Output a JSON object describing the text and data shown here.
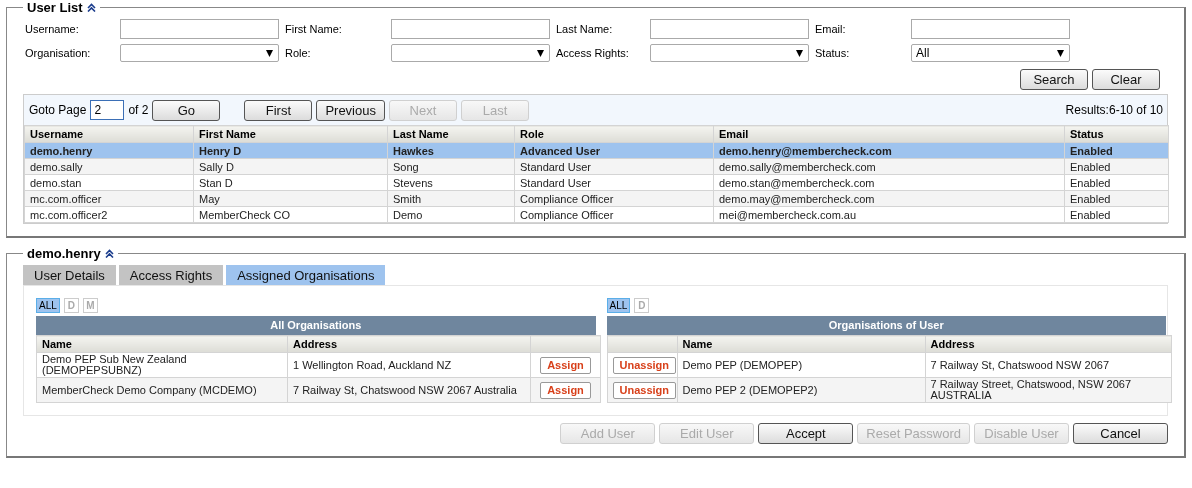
{
  "user_list": {
    "title": "User List",
    "filters": [
      {
        "kind": "text",
        "label": "Username:"
      },
      {
        "kind": "text",
        "label": "First Name:"
      },
      {
        "kind": "text",
        "label": "Last Name:"
      },
      {
        "kind": "text",
        "label": "Email:"
      },
      {
        "kind": "select",
        "label": "Organisation:"
      },
      {
        "kind": "select",
        "label": "Role:"
      },
      {
        "kind": "select",
        "label": "Access Rights:"
      },
      {
        "kind": "select",
        "label": "Status:",
        "value": "All"
      }
    ],
    "buttons": [
      {
        "label": "Search"
      },
      {
        "label": "Clear"
      }
    ],
    "pager": {
      "goto_label": "Goto Page",
      "page": "2",
      "of": "of 2",
      "go": "Go",
      "buttons": [
        {
          "label": "First",
          "disabled": false
        },
        {
          "label": "Previous",
          "disabled": false
        },
        {
          "label": "Next",
          "disabled": true
        },
        {
          "label": "Last",
          "disabled": true
        }
      ],
      "results": "Results:6-10 of 10"
    },
    "table": {
      "columns": [
        "Username",
        "First Name",
        "Last Name",
        "Role",
        "Email",
        "Status"
      ],
      "rows": [
        {
          "selected": true,
          "cells": [
            "demo.henry",
            "Henry D",
            "Hawkes",
            "Advanced User",
            "demo.henry@membercheck.com",
            "Enabled"
          ]
        },
        {
          "selected": false,
          "cells": [
            "demo.sally",
            "Sally D",
            "Song",
            "Standard User",
            "demo.sally@membercheck.com",
            "Enabled"
          ]
        },
        {
          "selected": false,
          "cells": [
            "demo.stan",
            "Stan D",
            "Stevens",
            "Standard User",
            "demo.stan@membercheck.com",
            "Enabled"
          ]
        },
        {
          "selected": false,
          "cells": [
            "mc.com.officer",
            "May",
            "Smith",
            "Compliance Officer",
            "demo.may@membercheck.com",
            "Enabled"
          ]
        },
        {
          "selected": false,
          "cells": [
            "mc.com.officer2",
            "MemberCheck CO",
            "Demo",
            "Compliance Officer",
            "mei@membercheck.com.au",
            "Enabled"
          ]
        }
      ]
    }
  },
  "user_panel": {
    "title": "demo.henry",
    "tabs": [
      {
        "label": "User Details",
        "selected": false
      },
      {
        "label": "Access Rights",
        "selected": false
      },
      {
        "label": "Assigned Organisations",
        "selected": true
      }
    ],
    "org_tables": [
      {
        "kind": "available",
        "filters": [
          {
            "label": "ALL",
            "selected": true
          },
          {
            "label": "D",
            "selected": false
          },
          {
            "label": "M",
            "selected": false
          }
        ],
        "title": "All Organisations",
        "columns": [
          "Name",
          "Address"
        ],
        "rows": [
          {
            "name": "Demo PEP Sub New Zealand (DEMOPEPSUBNZ)",
            "address": "1 Wellington Road, Auckland NZ",
            "action": "Assign"
          },
          {
            "name": "MemberCheck Demo Company (MCDEMO)",
            "address": "7 Railway St, Chatswood NSW 2067 Australia",
            "action": "Assign"
          }
        ]
      },
      {
        "kind": "assigned",
        "filters": [
          {
            "label": "ALL",
            "selected": true
          },
          {
            "label": "D",
            "selected": false
          }
        ],
        "title": "Organisations of User",
        "columns": [
          "Name",
          "Address"
        ],
        "rows": [
          {
            "name": "Demo PEP (DEMOPEP)",
            "address": "7 Railway St, Chatswood NSW 2067",
            "action": "Unassign"
          },
          {
            "name": "Demo PEP 2 (DEMOPEP2)",
            "address": "7 Railway Street, Chatswood, NSW 2067 AUSTRALIA",
            "action": "Unassign"
          }
        ]
      }
    ],
    "buttons": [
      {
        "label": "Add User",
        "disabled": true
      },
      {
        "label": "Edit User",
        "disabled": true
      },
      {
        "label": "Accept",
        "disabled": false
      },
      {
        "label": "Reset Password",
        "disabled": true
      },
      {
        "label": "Disable User",
        "disabled": true
      },
      {
        "label": "Cancel",
        "disabled": false
      }
    ]
  }
}
